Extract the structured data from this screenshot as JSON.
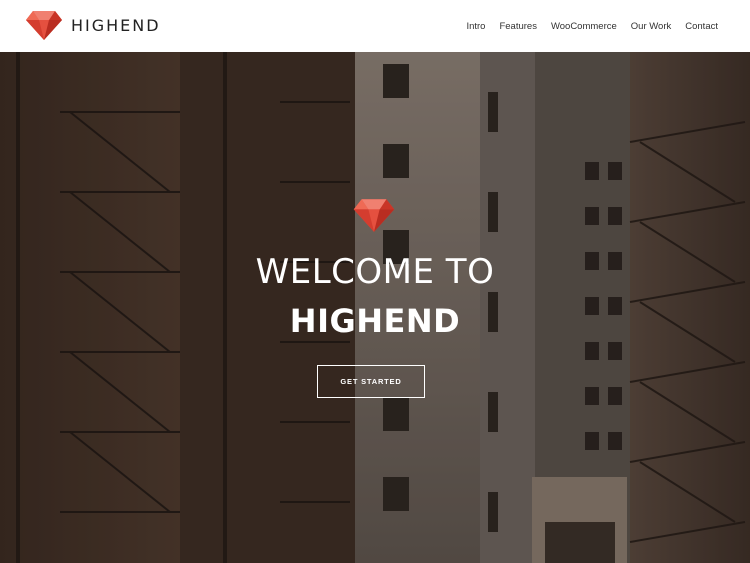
{
  "brand": {
    "name": "HIGHEND",
    "logo_icon": "ruby-gem-icon",
    "accent": "#e0473a"
  },
  "nav": {
    "items": [
      {
        "label": "Intro"
      },
      {
        "label": "Features"
      },
      {
        "label": "WooCommerce"
      },
      {
        "label": "Our Work"
      },
      {
        "label": "Contact"
      }
    ]
  },
  "hero": {
    "title_line1": "WELCOME TO",
    "title_line2": "HIGHEND",
    "cta_label": "GET STARTED",
    "gem_icon": "ruby-gem-icon"
  }
}
